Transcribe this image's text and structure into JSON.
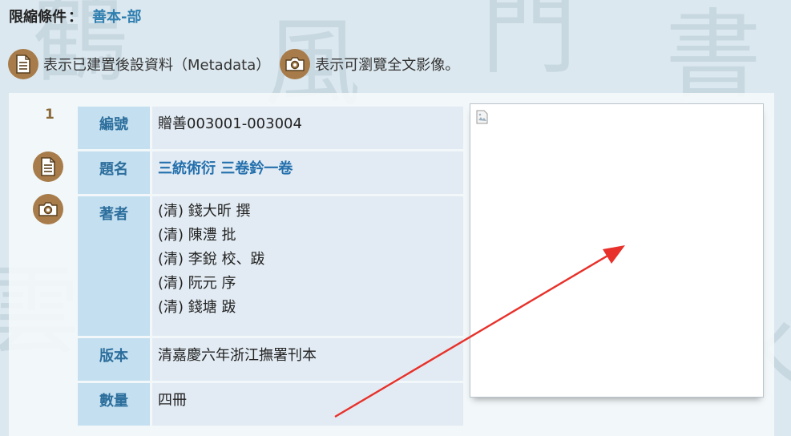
{
  "filter": {
    "label": "限縮條件",
    "colon": "：",
    "value": "善本-部"
  },
  "legend": {
    "metadata_text": "表示已建置後設資料（Metadata）",
    "image_text": "表示可瀏覽全文影像。",
    "icon_color": "#a77c4a"
  },
  "record": {
    "number": "1",
    "fields": {
      "id_label": "編號",
      "id_value": "贈善003001-003004",
      "title_label": "題名",
      "title_value": "三統術衍 三卷鈐一卷",
      "author_label": "著者",
      "authors": [
        "(清) 錢大昕 撰",
        "(清) 陳澧 批",
        "(清) 李銳 校、跋",
        "(清) 阮元 序",
        "(清) 錢塘 跋"
      ],
      "edition_label": "版本",
      "edition_value": "清嘉慶六年浙江撫署刊本",
      "quantity_label": "數量",
      "quantity_value": "四冊"
    }
  },
  "colors": {
    "label_bg": "#c3dff0",
    "label_text": "#2c6e9c",
    "value_bg": "#e2ebf3",
    "link": "#2470ad",
    "annotation_arrow": "#e8312b"
  }
}
